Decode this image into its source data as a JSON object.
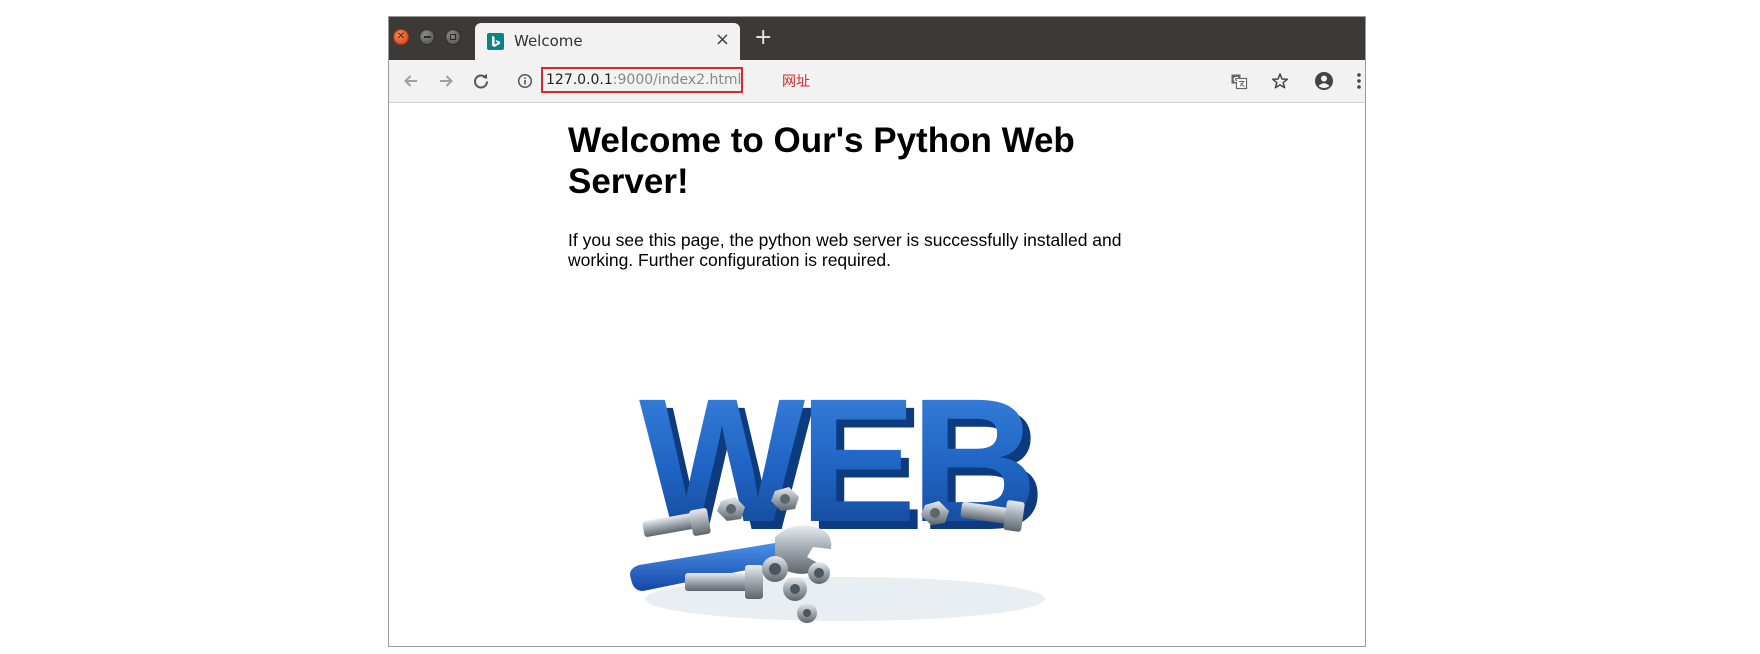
{
  "window": {
    "tab_title": "Welcome",
    "tab_close": "×",
    "new_tab": "+"
  },
  "toolbar": {
    "url_host": "127.0.0.1",
    "url_path": ":9000/index2.html",
    "url_annotation": "网址"
  },
  "page": {
    "heading": "Welcome to Our's Python Web Server!",
    "paragraph": "If you see this page, the python web server is successfully installed and working. Further configuration is required.",
    "image_text": "WEB"
  },
  "icons": {
    "favicon": "bing-icon",
    "back": "arrow-left-icon",
    "forward": "arrow-right-icon",
    "reload": "reload-icon",
    "site_info": "info-icon",
    "translate": "translate-icon",
    "bookmark": "star-icon",
    "account": "account-icon",
    "menu": "kebab-menu-icon"
  },
  "colors": {
    "titlebar": "#3b3a36",
    "toolbar": "#f2f2f2",
    "url_highlight": "#d8282a",
    "favicon": "#0b8484",
    "web_blue": "#1d5fb8"
  }
}
